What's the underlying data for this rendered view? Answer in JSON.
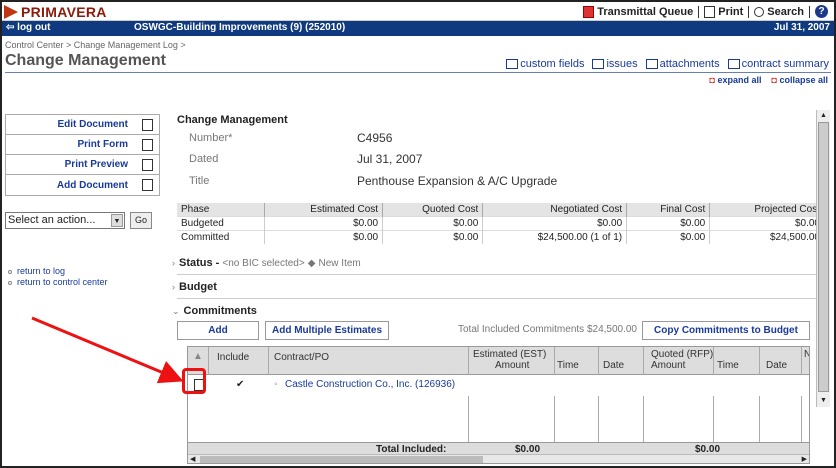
{
  "app": {
    "name": "PRIMAVERA"
  },
  "top_links": [
    {
      "icon": "transmittal-icon",
      "label": "Transmittal Queue"
    },
    {
      "icon": "print-icon",
      "label": "Print"
    },
    {
      "icon": "search-icon",
      "label": "Search"
    },
    {
      "icon": "help-icon",
      "label": ""
    }
  ],
  "nav": {
    "logout": "log out",
    "project": "OSWGC-Building Improvements (9) (252010)",
    "date": "Jul 31, 2007"
  },
  "breadcrumb": "Control Center > Change Management Log >",
  "page_title": "Change Management",
  "tool_links": [
    "custom fields",
    "issues",
    "attachments",
    "contract summary"
  ],
  "expand_all": "expand all",
  "collapse_all": "collapse all",
  "side_buttons": [
    "Edit Document",
    "Print Form",
    "Print Preview",
    "Add Document"
  ],
  "action_select": "Select an action...",
  "go": "Go",
  "side_links": [
    "return to log",
    "return to control center"
  ],
  "section_title": "Change Management",
  "fields": {
    "number_label": "Number*",
    "number": "C4956",
    "dated_label": "Dated",
    "dated": "Jul 31, 2007",
    "title_label": "Title",
    "title": "Penthouse Expansion & A/C Upgrade"
  },
  "phase_table": {
    "headers": [
      "Phase",
      "Estimated Cost",
      "Quoted Cost",
      "Negotiated Cost",
      "Final Cost",
      "Projected Cost"
    ],
    "rows": [
      [
        "Budgeted",
        "$0.00",
        "$0.00",
        "$0.00",
        "$0.00",
        "$0.00"
      ],
      [
        "Committed",
        "$0.00",
        "$0.00",
        "$24,500.00 (1 of 1)",
        "$0.00",
        "$24,500.00"
      ]
    ]
  },
  "status": {
    "label": "Status -",
    "sub": "<no BIC selected>",
    "item": "New Item"
  },
  "budget": "Budget",
  "commitments": {
    "label": "Commitments",
    "add": "Add",
    "add_multiple": "Add Multiple Estimates",
    "total_included_text": "Total Included Commitments $24,500.00",
    "copy": "Copy Commitments to Budget",
    "headers": {
      "include": "Include",
      "contract": "Contract/PO",
      "est1": "Estimated (EST)",
      "est2": "Amount",
      "time": "Time",
      "date": "Date",
      "quoted1": "Quoted (RFP)",
      "quoted2": "Amount",
      "time2": "Time",
      "date2": "Date",
      "n": "N"
    },
    "row": {
      "include": "✔",
      "contract": "Castle Construction Co., Inc. (126936)"
    },
    "footer": {
      "label": "Total Included:",
      "est": "$0.00",
      "quoted": "$0.00"
    }
  }
}
